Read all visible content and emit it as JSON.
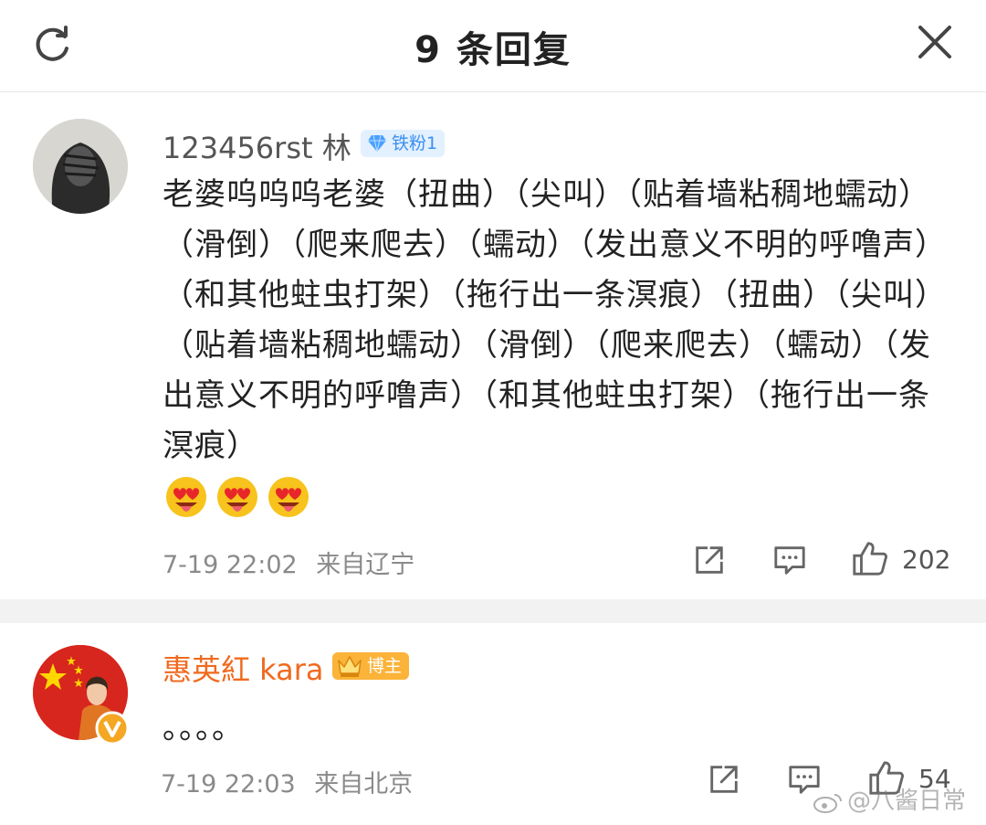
{
  "header": {
    "title": "9 条回复"
  },
  "comments": [
    {
      "username": "123456rst 林",
      "badge": "铁粉1",
      "text": "老婆呜呜呜老婆（扭曲）（尖叫）（贴着墙粘稠地蠕动）（滑倒）（爬来爬去）（蠕动）（发出意义不明的呼噜声）（和其他蛀虫打架）（拖行出一条溟痕）（扭曲）（尖叫）（贴着墙粘稠地蠕动）（滑倒）（爬来爬去）（蠕动）（发出意义不明的呼噜声）（和其他蛀虫打架）（拖行出一条溟痕）",
      "time": "7-19 22:02",
      "location": "来自辽宁",
      "likes": "202"
    },
    {
      "username": "惠英紅 kara",
      "badge": "博主",
      "text": "。。。。",
      "time": "7-19 22:03",
      "location": "来自北京",
      "likes": "54"
    }
  ],
  "watermark": "@八酱日常",
  "colors": {
    "vip_name": "#f06a1f",
    "normal_name": "#555555",
    "badge_blue": "#3b8ff0",
    "badge_orange": "#f59c1a"
  }
}
